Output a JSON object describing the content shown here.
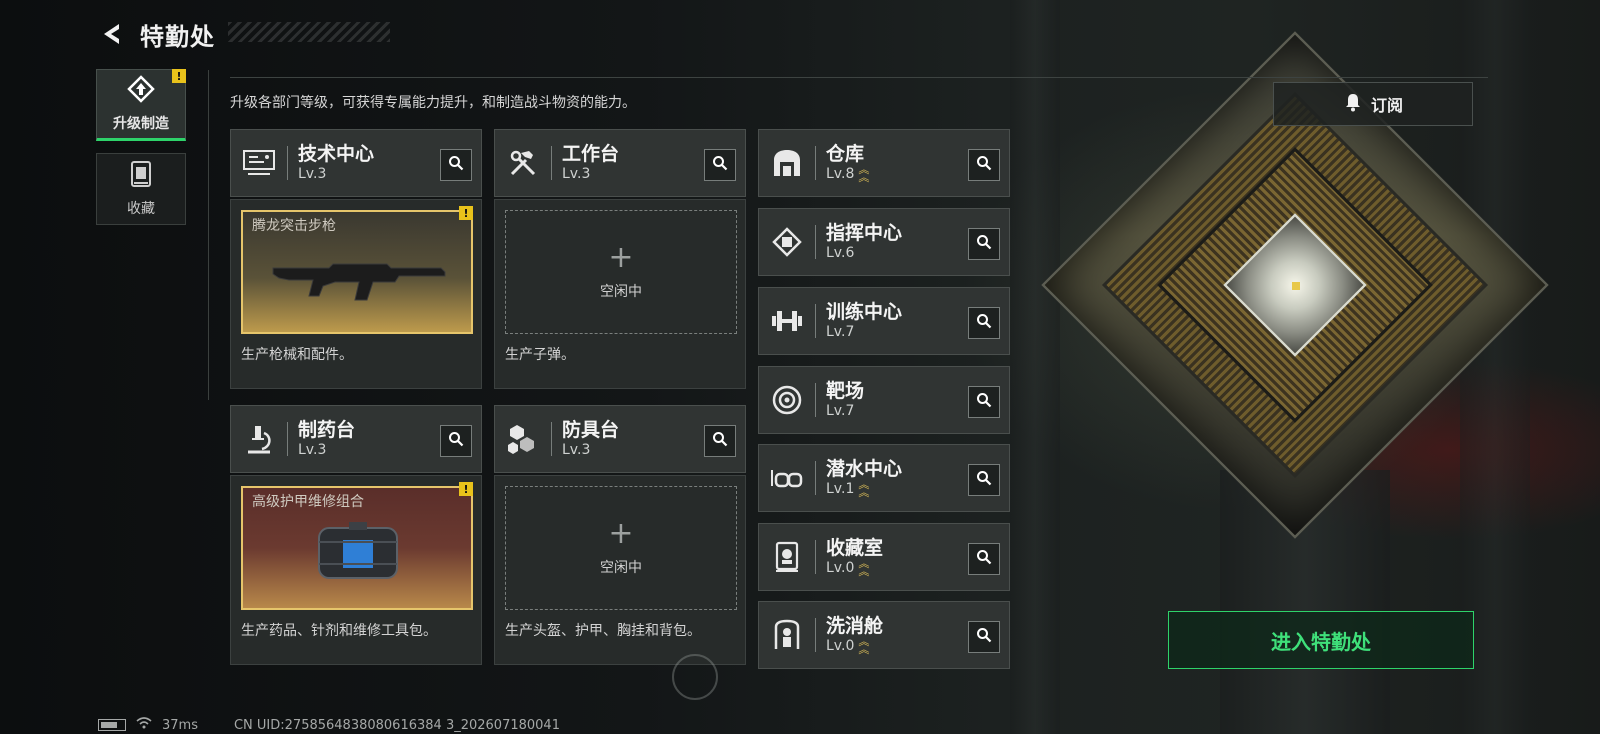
{
  "header": {
    "title": "特勤处"
  },
  "sidebar": {
    "tabs": [
      {
        "label": "升级制造",
        "active": true,
        "badge": "!"
      },
      {
        "label": "收藏",
        "active": false
      }
    ]
  },
  "description": "升级各部门等级，可获得专属能力提升，和制造战斗物资的能力。",
  "subscribe": {
    "label": "订阅",
    "icon": "bell-icon"
  },
  "production_departments": [
    {
      "name": "技术中心",
      "level": "Lv.3",
      "icon": "monitor-icon",
      "slot": {
        "state": "producing",
        "item": "腾龙突击步枪",
        "badge": "!"
      },
      "desc": "生产枪械和配件。"
    },
    {
      "name": "工作台",
      "level": "Lv.3",
      "icon": "hammer-wrench-icon",
      "slot": {
        "state": "idle",
        "plus": "+",
        "idle_text": "空闲中"
      },
      "desc": "生产子弹。"
    },
    {
      "name": "制药台",
      "level": "Lv.3",
      "icon": "microscope-icon",
      "slot": {
        "state": "producing",
        "item": "高级护甲维修组合",
        "badge": "!"
      },
      "desc": "生产药品、针剂和维修工具包。"
    },
    {
      "name": "防具台",
      "level": "Lv.3",
      "icon": "cubes-icon",
      "slot": {
        "state": "idle",
        "plus": "+",
        "idle_text": "空闲中"
      },
      "desc": "生产头盔、护甲、胸挂和背包。"
    }
  ],
  "departments": [
    {
      "name": "仓库",
      "level": "Lv.8",
      "upgradable": true,
      "icon": "warehouse-icon"
    },
    {
      "name": "指挥中心",
      "level": "Lv.6",
      "upgradable": false,
      "icon": "chip-icon"
    },
    {
      "name": "训练中心",
      "level": "Lv.7",
      "upgradable": false,
      "icon": "dumbbell-icon"
    },
    {
      "name": "靶场",
      "level": "Lv.7",
      "upgradable": false,
      "icon": "target-icon"
    },
    {
      "name": "潜水中心",
      "level": "Lv.1",
      "upgradable": true,
      "icon": "diving-goggles-icon"
    },
    {
      "name": "收藏室",
      "level": "Lv.0",
      "upgradable": true,
      "icon": "display-case-icon"
    },
    {
      "name": "洗消舱",
      "level": "Lv.0",
      "upgradable": true,
      "icon": "decontamination-icon"
    }
  ],
  "enter_button": {
    "label": "进入特勤处"
  },
  "status_bar": {
    "ping": "37ms",
    "uid": "CN UID:2758564838080616384 3_202607180041"
  },
  "colors": {
    "accent_green": "#2ed36a",
    "warning_yellow": "#e8c21b",
    "upgrade_gold": "#e3c35a"
  }
}
